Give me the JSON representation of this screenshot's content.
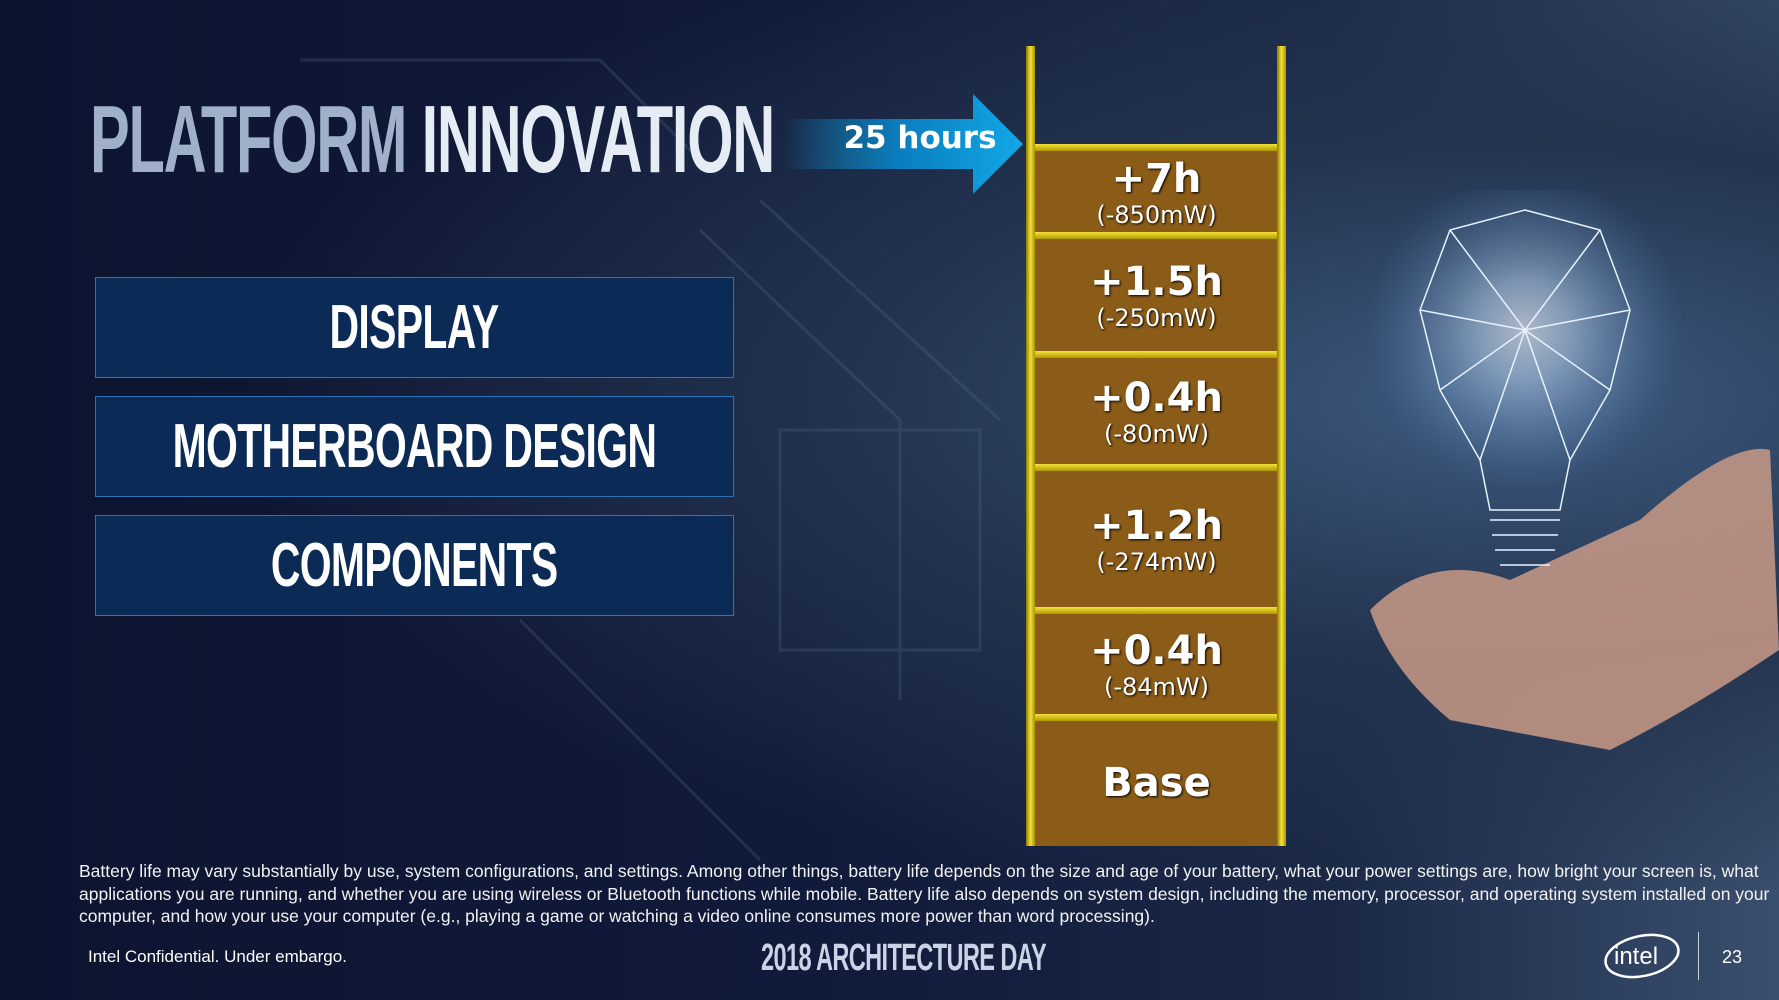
{
  "title": {
    "part1": "PLATFORM",
    "part2": "INNOVATION"
  },
  "categories": [
    "DISPLAY",
    "MOTHERBOARD DESIGN",
    "COMPONENTS"
  ],
  "arrow_label": "25 hours",
  "stack": [
    {
      "hours": "+7h",
      "power": "(-850mW)"
    },
    {
      "hours": "+1.5h",
      "power": "(-250mW)"
    },
    {
      "hours": "+0.4h",
      "power": "(-80mW)"
    },
    {
      "hours": "+1.2h",
      "power": "(-274mW)"
    },
    {
      "hours": "+0.4h",
      "power": "(-84mW)"
    }
  ],
  "base_label": "Base",
  "disclaimer": "Battery life may vary substantially by use, system configurations, and settings. Among other things, battery life depends on the size and age of your battery, what your power settings are, how bright your screen is, what applications you are running, and whether you are using wireless or Bluetooth functions while mobile. Battery life also depends on system design, including the memory, processor, and operating system installed on your computer, and how your use your computer (e.g., playing a game or watching a video online consumes more power than word processing).",
  "footer": {
    "confidential": "Intel Confidential.  Under embargo.",
    "event": "2018 ARCHITECTURE DAY",
    "logo": "intel",
    "page": "23"
  },
  "colors": {
    "box": "#0b2a55",
    "arrow": "#0a9ad8",
    "segment": "#8b5b18",
    "rail": "#f4e23a"
  }
}
